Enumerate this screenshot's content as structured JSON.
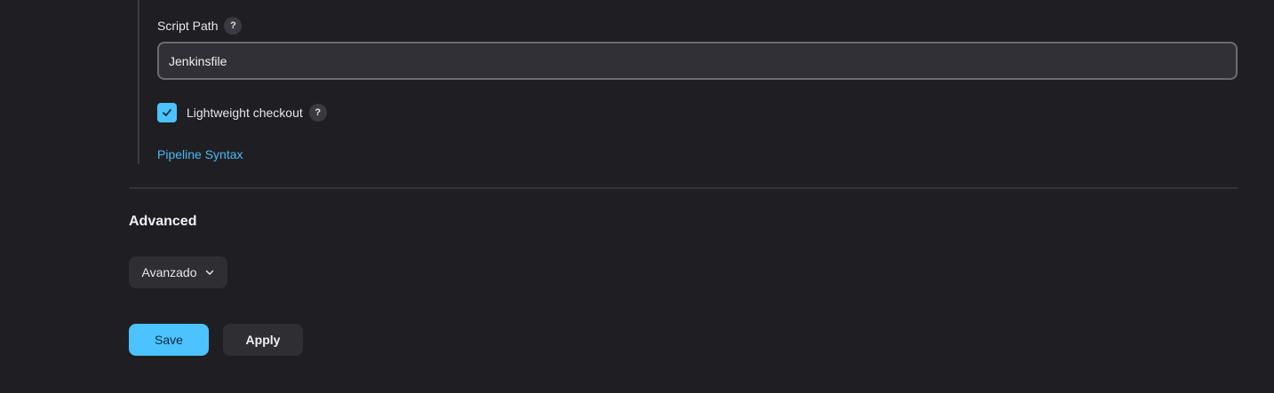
{
  "script_path": {
    "label": "Script Path",
    "help": "?",
    "value": "Jenkinsfile"
  },
  "lightweight_checkout": {
    "label": "Lightweight checkout",
    "help": "?",
    "checked": true
  },
  "pipeline_syntax_link": "Pipeline Syntax",
  "advanced": {
    "heading": "Advanced",
    "dropdown_label": "Avanzado",
    "dropdown_icon": "chevron-down-icon"
  },
  "actions": {
    "save_label": "Save",
    "apply_label": "Apply"
  },
  "colors": {
    "background": "#1f1f23",
    "accent": "#4cc3ff",
    "link": "#4cb8f0"
  }
}
